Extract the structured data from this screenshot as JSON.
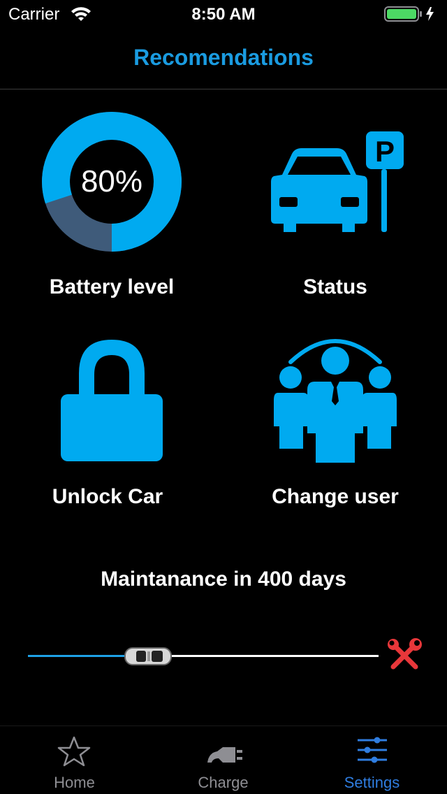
{
  "status_bar": {
    "carrier": "Carrier",
    "time": "8:50 AM"
  },
  "nav": {
    "title": "Recomendations"
  },
  "tiles": {
    "battery": {
      "value_label": "80%",
      "percent": 80,
      "label": "Battery level"
    },
    "status": {
      "label": "Status",
      "icon": "car-parking-icon"
    },
    "unlock": {
      "label": "Unlock Car",
      "icon": "lock-icon"
    },
    "change_user": {
      "label": "Change user",
      "icon": "users-icon"
    }
  },
  "maintenance": {
    "text": "Maintanance in 400 days",
    "progress": 0.3
  },
  "tab_bar": {
    "tabs": [
      {
        "label": "Home",
        "icon": "star-icon",
        "active": false
      },
      {
        "label": "Charge",
        "icon": "plug-icon",
        "active": false
      },
      {
        "label": "Settings",
        "icon": "sliders-icon",
        "active": true
      }
    ]
  },
  "colors": {
    "accent": "#00aaf0",
    "accent_dark": "#3f5b7a",
    "title": "#1a9be0",
    "tab_active": "#2f7de0",
    "tab_inactive": "#8e8e93",
    "battery_green": "#4cd964",
    "wrench_red": "#e8373a"
  }
}
